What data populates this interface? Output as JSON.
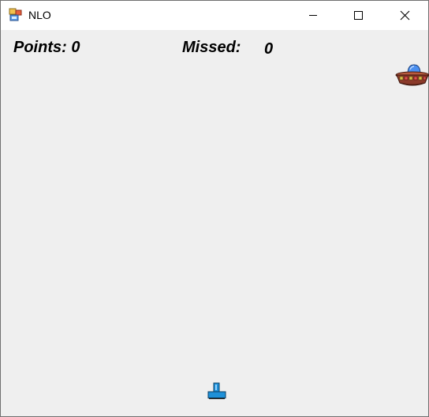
{
  "window": {
    "title": "NLO",
    "controls": {
      "minimize": "minimize-icon",
      "maximize": "maximize-icon",
      "close": "close-icon"
    }
  },
  "hud": {
    "points_label": "Points: 0",
    "missed_label": "Missed:",
    "missed_value": "0"
  },
  "game": {
    "ufo_icon": "ufo-sprite",
    "cannon_icon": "cannon-sprite",
    "colors": {
      "ufo_dome": "#4a8ff0",
      "ufo_body": "#8b3a2a",
      "ufo_lights": "#d8c24a",
      "cannon": "#1e90d8",
      "background": "#efefef"
    }
  }
}
